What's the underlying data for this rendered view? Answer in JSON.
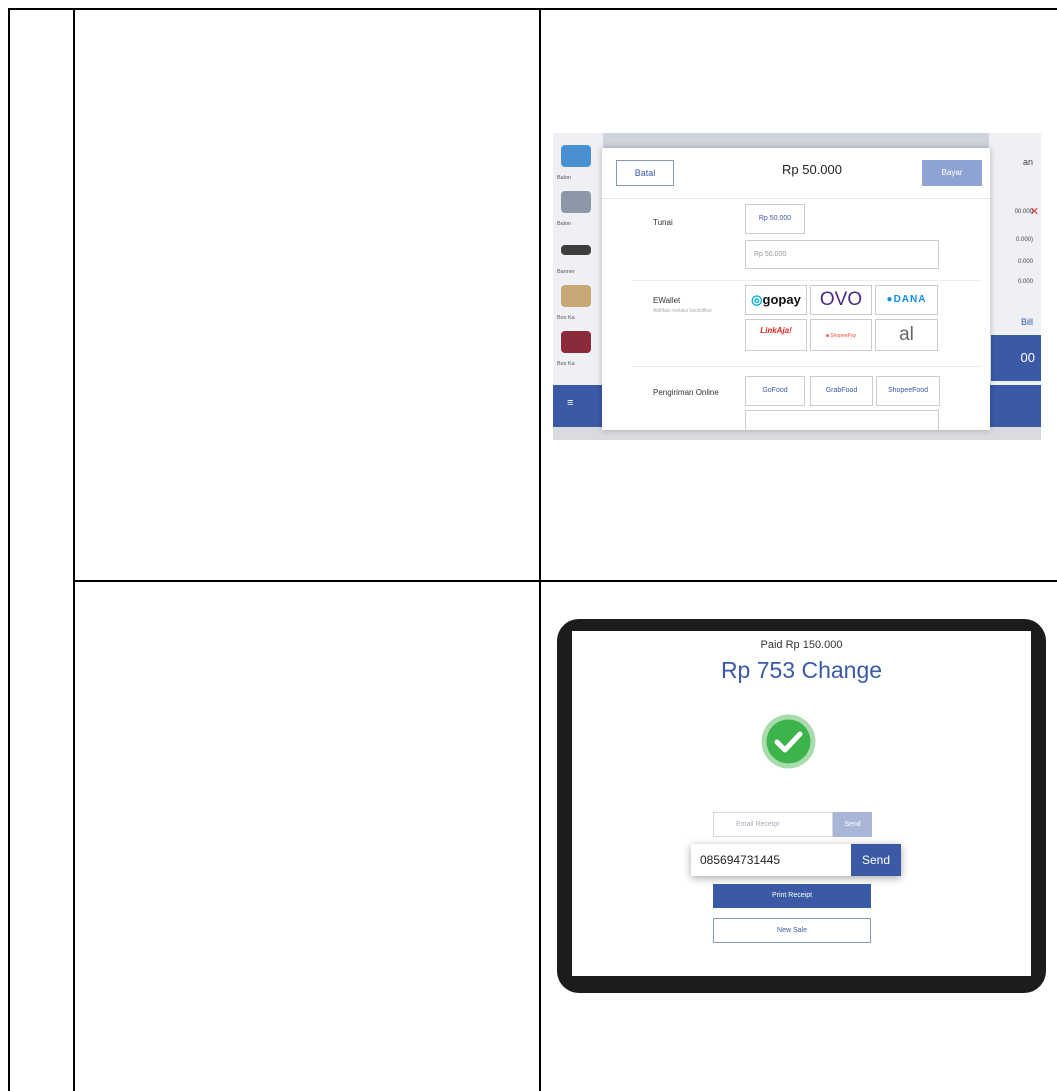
{
  "payment_dialog": {
    "cancel_label": "Batal",
    "amount": "Rp 50.000",
    "pay_label": "Bayar",
    "cash": {
      "label": "Tunai",
      "quick_amount": "Rp 50.000",
      "input_value": "Rp 50.000"
    },
    "ewallet": {
      "label": "EWallet",
      "sub": "Aktifkan melalui backoffice",
      "options": [
        "gopay",
        "OVO",
        "DANA",
        "LinkAja!",
        "ShopeePay",
        "al"
      ]
    },
    "online_delivery": {
      "label": "Pengiriman Online",
      "options": [
        "GoFood",
        "GrabFood",
        "ShopeeFood"
      ]
    },
    "background": {
      "items": [
        "Balon",
        "Balon",
        "Banner",
        "Box Ka",
        "Box Ka"
      ],
      "right_values": [
        "00.000",
        "0.000)",
        "0.000",
        "0.000"
      ],
      "right_title": "an",
      "bill_label": "Bill",
      "pay_amount": "00"
    }
  },
  "receipt_screen": {
    "paid_text": "Paid Rp 150.000",
    "change_text": "Rp 753 Change",
    "email_placeholder": "Email Receipt",
    "email_send": "Send",
    "phone_value": "085694731445",
    "phone_send": "Send",
    "print_label": "Print Receipt",
    "new_sale_label": "New Sale"
  },
  "colors": {
    "brand_blue": "#3a5aa6",
    "success_green": "#3cb44b"
  }
}
